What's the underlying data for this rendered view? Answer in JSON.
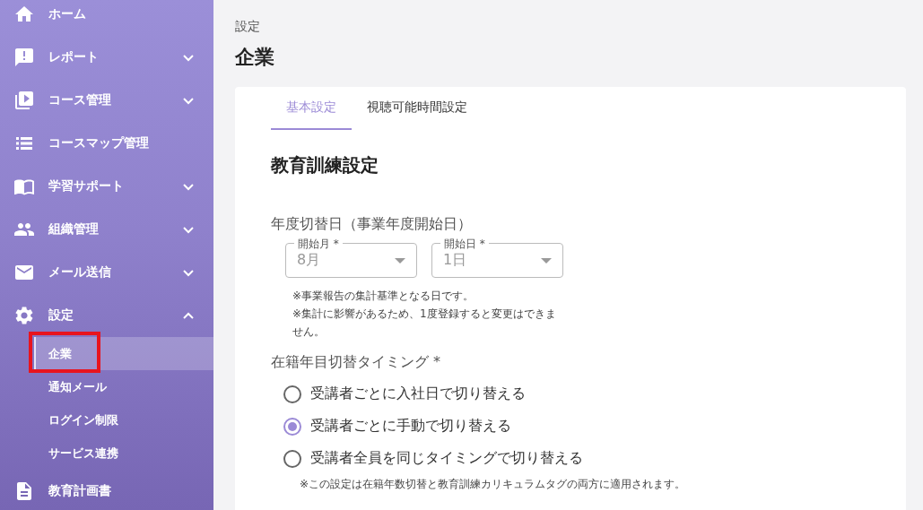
{
  "sidebar": {
    "items": [
      {
        "kind": "link",
        "label": "ホーム"
      },
      {
        "kind": "group",
        "label": "レポート",
        "expanded": false
      },
      {
        "kind": "group",
        "label": "コース管理",
        "expanded": false
      },
      {
        "kind": "link",
        "label": "コースマップ管理"
      },
      {
        "kind": "group",
        "label": "学習サポート",
        "expanded": false
      },
      {
        "kind": "group",
        "label": "組織管理",
        "expanded": false
      },
      {
        "kind": "group",
        "label": "メール送信",
        "expanded": false
      },
      {
        "kind": "group",
        "label": "設定",
        "expanded": true,
        "children": [
          {
            "label": "企業",
            "selected": true,
            "annotated": true
          },
          {
            "label": "通知メール",
            "selected": false,
            "annotated": false
          },
          {
            "label": "ログイン制限",
            "selected": false,
            "annotated": false
          },
          {
            "label": "サービス連携",
            "selected": false,
            "annotated": false
          }
        ]
      },
      {
        "kind": "link",
        "label": "教育計画書"
      }
    ]
  },
  "breadcrumb": "設定",
  "title": "企業",
  "tabs": [
    {
      "label": "基本設定",
      "selected": true
    },
    {
      "label": "視聴可能時間設定",
      "selected": false
    }
  ],
  "section_title": "教育訓練設定",
  "fiscal": {
    "label": "年度切替日（事業年度開始日）",
    "selects": [
      {
        "label": "開始月 *",
        "value": "8月",
        "disabled": true
      },
      {
        "label": "開始日 *",
        "value": "1日",
        "disabled": true
      }
    ],
    "notes": [
      "※事業報告の集計基準となる日です。",
      "※集計に影響があるため、1度登録すると変更はできません。"
    ]
  },
  "timing": {
    "label": "在籍年目切替タイミング *",
    "options": [
      {
        "label": "受講者ごとに入社日で切り替える",
        "selected": false
      },
      {
        "label": "受講者ごとに手動で切り替える",
        "selected": true
      },
      {
        "label": "受講者全員を同じタイミングで切り替える",
        "selected": false
      }
    ],
    "note": "※この設定は在籍年数切替と教育訓練カリキュラムタグの両方に適用されます。"
  }
}
